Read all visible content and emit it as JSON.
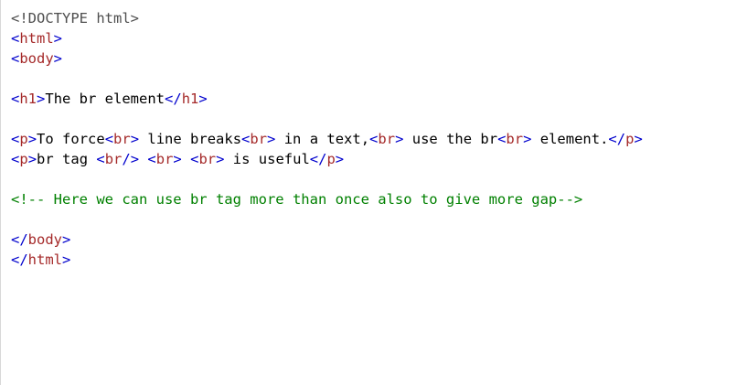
{
  "colors": {
    "background": "#ffffff",
    "bracket": "#0000cd",
    "tag_name": "#a52a2a",
    "text": "#000000",
    "comment": "#008000",
    "doctype": "#4e4e4e"
  },
  "code_lines": [
    [
      {
        "t": "doctype",
        "v": "<!DOCTYPE html>"
      }
    ],
    [
      {
        "t": "bracket",
        "v": "<"
      },
      {
        "t": "tag",
        "v": "html"
      },
      {
        "t": "bracket",
        "v": ">"
      }
    ],
    [
      {
        "t": "bracket",
        "v": "<"
      },
      {
        "t": "tag",
        "v": "body"
      },
      {
        "t": "bracket",
        "v": ">"
      }
    ],
    [],
    [
      {
        "t": "bracket",
        "v": "<"
      },
      {
        "t": "tag",
        "v": "h1"
      },
      {
        "t": "bracket",
        "v": ">"
      },
      {
        "t": "text",
        "v": "The br element"
      },
      {
        "t": "bracket",
        "v": "</"
      },
      {
        "t": "tag",
        "v": "h1"
      },
      {
        "t": "bracket",
        "v": ">"
      }
    ],
    [],
    [
      {
        "t": "bracket",
        "v": "<"
      },
      {
        "t": "tag",
        "v": "p"
      },
      {
        "t": "bracket",
        "v": ">"
      },
      {
        "t": "text",
        "v": "To force"
      },
      {
        "t": "bracket",
        "v": "<"
      },
      {
        "t": "tag",
        "v": "br"
      },
      {
        "t": "bracket",
        "v": ">"
      },
      {
        "t": "text",
        "v": " line breaks"
      },
      {
        "t": "bracket",
        "v": "<"
      },
      {
        "t": "tag",
        "v": "br"
      },
      {
        "t": "bracket",
        "v": ">"
      },
      {
        "t": "text",
        "v": " in a text,"
      },
      {
        "t": "bracket",
        "v": "<"
      },
      {
        "t": "tag",
        "v": "br"
      },
      {
        "t": "bracket",
        "v": ">"
      },
      {
        "t": "text",
        "v": " use the br"
      },
      {
        "t": "bracket",
        "v": "<"
      },
      {
        "t": "tag",
        "v": "br"
      },
      {
        "t": "bracket",
        "v": ">"
      },
      {
        "t": "text",
        "v": " element."
      },
      {
        "t": "bracket",
        "v": "</"
      },
      {
        "t": "tag",
        "v": "p"
      },
      {
        "t": "bracket",
        "v": ">"
      }
    ],
    [
      {
        "t": "bracket",
        "v": "<"
      },
      {
        "t": "tag",
        "v": "p"
      },
      {
        "t": "bracket",
        "v": ">"
      },
      {
        "t": "text",
        "v": "br tag "
      },
      {
        "t": "bracket",
        "v": "<"
      },
      {
        "t": "tag",
        "v": "br"
      },
      {
        "t": "bracket",
        "v": "/>"
      },
      {
        "t": "text",
        "v": " "
      },
      {
        "t": "bracket",
        "v": "<"
      },
      {
        "t": "tag",
        "v": "br"
      },
      {
        "t": "bracket",
        "v": ">"
      },
      {
        "t": "text",
        "v": " "
      },
      {
        "t": "bracket",
        "v": "<"
      },
      {
        "t": "tag",
        "v": "br"
      },
      {
        "t": "bracket",
        "v": ">"
      },
      {
        "t": "text",
        "v": " is useful"
      },
      {
        "t": "bracket",
        "v": "</"
      },
      {
        "t": "tag",
        "v": "p"
      },
      {
        "t": "bracket",
        "v": ">"
      }
    ],
    [],
    [
      {
        "t": "comment",
        "v": "<!-- Here we can use br tag more than once also to give more gap-->"
      }
    ],
    [],
    [
      {
        "t": "bracket",
        "v": "</"
      },
      {
        "t": "tag",
        "v": "body"
      },
      {
        "t": "bracket",
        "v": ">"
      }
    ],
    [
      {
        "t": "bracket",
        "v": "</"
      },
      {
        "t": "tag",
        "v": "html"
      },
      {
        "t": "bracket",
        "v": ">"
      }
    ]
  ]
}
